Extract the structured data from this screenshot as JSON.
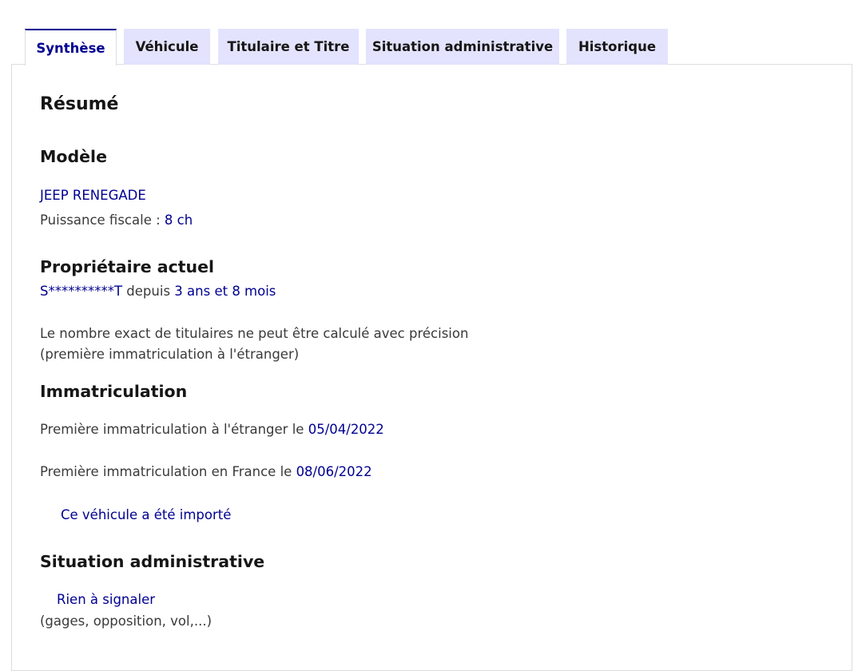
{
  "tabs": [
    {
      "label": "Synthèse",
      "active": true
    },
    {
      "label": "Véhicule",
      "active": false
    },
    {
      "label": "Titulaire et Titre",
      "active": false
    },
    {
      "label": "Situation administrative",
      "active": false
    },
    {
      "label": "Historique",
      "active": false
    }
  ],
  "resume": {
    "title": "Résumé"
  },
  "modele": {
    "title": "Modèle",
    "name": "JEEP RENEGADE",
    "puissance_label": "Puissance fiscale : ",
    "puissance_value": "8 ch"
  },
  "proprietaire": {
    "title": "Propriétaire actuel",
    "name": "S**********T",
    "depuis_label": " depuis ",
    "duration": "3 ans et 8 mois",
    "note_line1": "Le nombre exact de titulaires ne peut être calculé avec précision",
    "note_line2": "(première immatriculation à l'étranger)"
  },
  "immatriculation": {
    "title": "Immatriculation",
    "etranger_label": "Première immatriculation à l'étranger le ",
    "etranger_date": "05/04/2022",
    "france_label": "Première immatriculation en France le ",
    "france_date": "08/06/2022",
    "importe": "Ce véhicule a été importé"
  },
  "situation": {
    "title": "Situation administrative",
    "status": "Rien à signaler",
    "details": "(gages, opposition, vol,...)"
  },
  "colors": {
    "accent": "#000091",
    "tab_bg": "#e3e3fd",
    "text": "#3a3a3a",
    "heading": "#161616"
  }
}
